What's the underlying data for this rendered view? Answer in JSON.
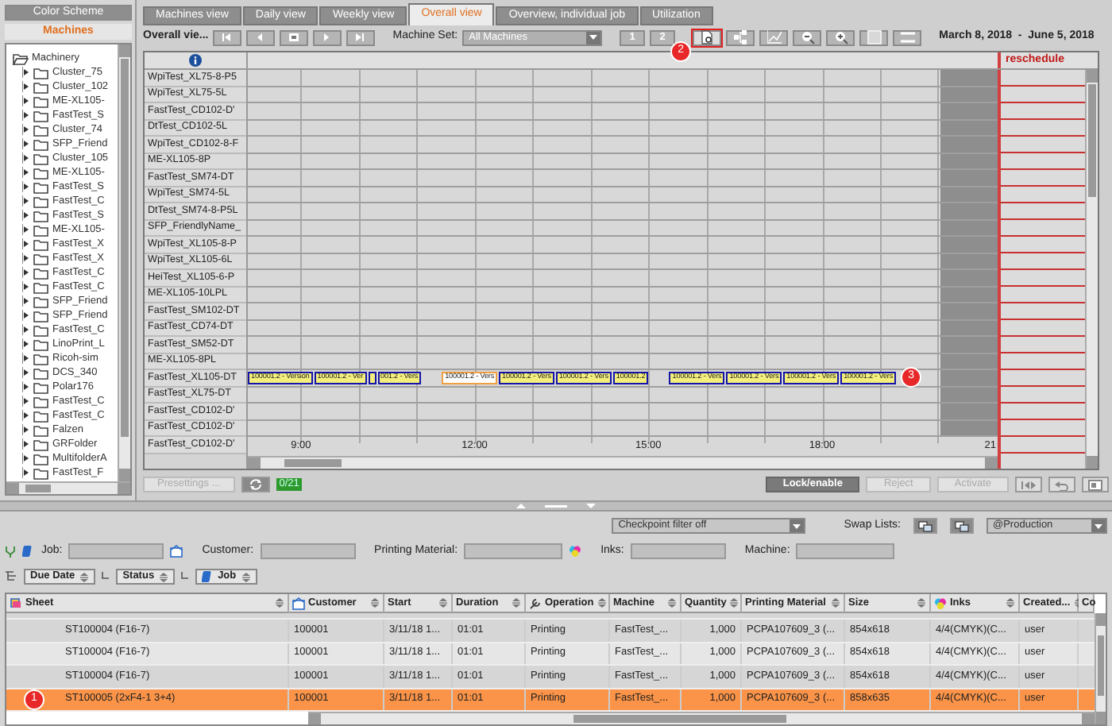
{
  "left_panel": {
    "tabs": [
      {
        "label": "Color Scheme",
        "selected": false
      },
      {
        "label": "Machines",
        "selected": true
      }
    ],
    "tree": {
      "label": "Machinery",
      "expanded": true,
      "children": [
        {
          "label": "Cluster_75"
        },
        {
          "label": "Cluster_102"
        },
        {
          "label": "ME-XL105-"
        },
        {
          "label": "FastTest_S"
        },
        {
          "label": "Cluster_74"
        },
        {
          "label": "SFP_Friend"
        },
        {
          "label": "Cluster_105"
        },
        {
          "label": "ME-XL105-"
        },
        {
          "label": "FastTest_S"
        },
        {
          "label": "FastTest_C"
        },
        {
          "label": "FastTest_S"
        },
        {
          "label": "ME-XL105-"
        },
        {
          "label": "FastTest_X"
        },
        {
          "label": "FastTest_X"
        },
        {
          "label": "FastTest_C"
        },
        {
          "label": "FastTest_C"
        },
        {
          "label": "SFP_Friend"
        },
        {
          "label": "SFP_Friend"
        },
        {
          "label": "FastTest_C"
        },
        {
          "label": "LinoPrint_L"
        },
        {
          "label": "Ricoh-sim"
        },
        {
          "label": "DCS_340"
        },
        {
          "label": "Polar176"
        },
        {
          "label": "FastTest_C"
        },
        {
          "label": "FastTest_C"
        },
        {
          "label": "Falzen"
        },
        {
          "label": "GRFolder"
        },
        {
          "label": "MultifolderA"
        },
        {
          "label": "FastTest_F"
        }
      ]
    }
  },
  "tabs": [
    {
      "label": "Machines view",
      "selected": false
    },
    {
      "label": "Daily view",
      "selected": false
    },
    {
      "label": "Weekly view",
      "selected": false
    },
    {
      "label": "Overall view",
      "selected": true
    },
    {
      "label": "Overview, individual job",
      "selected": false
    },
    {
      "label": "Utilization",
      "selected": false
    }
  ],
  "toolbar": {
    "title": "Overall vie...",
    "machine_set_label": "Machine Set:",
    "machine_set": "All Machines",
    "view_buttons": [
      "1",
      "2"
    ],
    "tools": [
      {
        "highlighted": true,
        "callout": "2"
      },
      {
        "highlighted": false
      },
      {
        "highlighted": false
      },
      {
        "highlighted": false
      },
      {
        "highlighted": false
      },
      {
        "highlighted": false
      },
      {
        "highlighted": false
      }
    ],
    "date_range": "March 8, 2018  -  June 5, 2018"
  },
  "gantt": {
    "reschedule_label": "reschedule",
    "axis": [
      "9:00",
      "12:00",
      "15:00",
      "18:00",
      "21"
    ],
    "machines": [
      {
        "name": "WpiTest_XL75-8-P5"
      },
      {
        "name": "WpiTest_XL75-5L"
      },
      {
        "name": "FastTest_CD102-D'"
      },
      {
        "name": "DtTest_CD102-5L"
      },
      {
        "name": "WpiTest_CD102-8-F"
      },
      {
        "name": "ME-XL105-8P"
      },
      {
        "name": "FastTest_SM74-DT"
      },
      {
        "name": "WpiTest_SM74-5L"
      },
      {
        "name": "DtTest_SM74-8-P5L"
      },
      {
        "name": "SFP_FriendlyName_"
      },
      {
        "name": "WpiTest_XL105-8-P"
      },
      {
        "name": "WpiTest_XL105-6L"
      },
      {
        "name": "HeiTest_XL105-6-P"
      },
      {
        "name": "ME-XL105-10LPL"
      },
      {
        "name": "FastTest_SM102-DT"
      },
      {
        "name": "FastTest_CD74-DT"
      },
      {
        "name": "FastTest_SM52-DT"
      },
      {
        "name": "ME-XL105-8PL"
      },
      {
        "name": "FastTest_XL105-DT",
        "bars": [
          {
            "label": "100001.2 - Version",
            "kind": "filled"
          },
          {
            "label": "100001.2 - Ver",
            "kind": "filled"
          },
          {
            "kind": "filled"
          },
          {
            "label": "001.2 - Vers",
            "kind": "filled"
          },
          {
            "label": "100001.2 - Vers",
            "kind": "outlined",
            "gap_before": true
          },
          {
            "label": "100001.2 - Vers",
            "kind": "filled"
          },
          {
            "label": "100001.2 - Vers",
            "kind": "filled"
          },
          {
            "label": "100001.2",
            "kind": "filled"
          },
          {
            "label": "100001.2 - Vers",
            "kind": "filled",
            "gap_before": true
          },
          {
            "label": "100001.2 - Vers",
            "kind": "filled"
          },
          {
            "label": "100001.2 - Vers",
            "kind": "filled"
          },
          {
            "label": "100001.2 - Vers",
            "kind": "filled",
            "callout": "3"
          }
        ]
      },
      {
        "name": "FastTest_XL75-DT"
      },
      {
        "name": "FastTest_CD102-D'"
      },
      {
        "name": "FastTest_CD102-D'"
      },
      {
        "name": "FastTest_CD102-D'"
      }
    ]
  },
  "action_bar": {
    "presettings": {
      "label": "Presettings ...",
      "disabled": true
    },
    "count": "0/21",
    "buttons": [
      {
        "label": "Lock/enable",
        "disabled": false
      },
      {
        "label": "Reject",
        "disabled": true
      },
      {
        "label": "Activate",
        "disabled": true
      }
    ]
  },
  "filter_bar": {
    "checkpoint_filter": "Checkpoint filter off",
    "swap_label": "Swap Lists:",
    "list": "@Production"
  },
  "search_fields": [
    {
      "label": "Job:"
    },
    {
      "label": "Customer:"
    },
    {
      "label": "Printing Material:"
    },
    {
      "label": "Inks:"
    },
    {
      "label": "Machine:"
    }
  ],
  "group_by": [
    "Due Date",
    "Status",
    "Job"
  ],
  "table": {
    "columns": [
      "Sheet",
      "Customer",
      "Start",
      "Duration",
      "Operation",
      "Machine",
      "Quantity",
      "Printing Material",
      "Size",
      "Inks",
      "Created...",
      "Co"
    ],
    "rows": [
      {
        "selected": false,
        "cells": [
          "ST100004 (F16-7)",
          "100001",
          "3/11/18 1...",
          "01:01",
          "Printing",
          "FastTest_...",
          "1,000",
          "PCPA107609_3 (...",
          "854x618",
          "4/4(CMYK)(C...",
          "user"
        ]
      },
      {
        "selected": false,
        "cells": [
          "ST100004 (F16-7)",
          "100001",
          "3/11/18 1...",
          "01:01",
          "Printing",
          "FastTest_...",
          "1,000",
          "PCPA107609_3 (...",
          "854x618",
          "4/4(CMYK)(C...",
          "user"
        ]
      },
      {
        "selected": false,
        "cells": [
          "ST100004 (F16-7)",
          "100001",
          "3/11/18 1...",
          "01:01",
          "Printing",
          "FastTest_...",
          "1,000",
          "PCPA107609_3 (...",
          "854x618",
          "4/4(CMYK)(C...",
          "user"
        ]
      },
      {
        "selected": true,
        "callout": "1",
        "cells": [
          "ST100005 (2xF4-1 3+4)",
          "100001",
          "3/11/18 1...",
          "01:01",
          "Printing",
          "FastTest_...",
          "1,000",
          "PCPA107609_3 (...",
          "858x635",
          "4/4(CMYK)(C...",
          "user"
        ]
      }
    ]
  }
}
